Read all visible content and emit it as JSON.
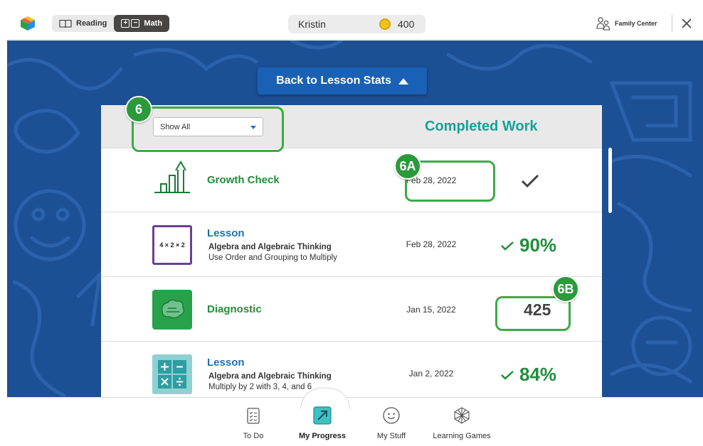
{
  "topbar": {
    "subjects": [
      {
        "label": "Reading",
        "active": false
      },
      {
        "label": "Math",
        "active": true
      }
    ],
    "user_name": "Kristin",
    "coins": "400",
    "family_center": "Family Center"
  },
  "stage": {
    "back_button": "Back to Lesson Stats",
    "filter_value": "Show All",
    "panel_title": "Completed Work"
  },
  "rows": [
    {
      "icon": "growth-check-icon",
      "title": "Growth Check",
      "date": "Feb 28, 2022",
      "result_icon": "checkmark-icon"
    },
    {
      "icon": "lesson-multiply-icon",
      "icon_text": "4 × 2 × 2",
      "title": "Lesson",
      "subtitle": "Algebra and Algebraic Thinking",
      "detail": "Use Order and Grouping to Multiply",
      "date": "Feb 28, 2022",
      "score": "90%"
    },
    {
      "icon": "diagnostic-brain-icon",
      "title": "Diagnostic",
      "date": "Jan 15, 2022",
      "score": "425"
    },
    {
      "icon": "lesson-operations-icon",
      "title": "Lesson",
      "subtitle": "Algebra and Algebraic Thinking",
      "detail": "Multiply by 2 with 3, 4, and 6",
      "date": "Jan 2, 2022",
      "score": "84%"
    }
  ],
  "callouts": {
    "filter": "6",
    "date": "6A",
    "score": "6B"
  },
  "nav": [
    {
      "label": "To Do",
      "icon": "todo-icon"
    },
    {
      "label": "My Progress",
      "icon": "progress-icon",
      "active": true
    },
    {
      "label": "My Stuff",
      "icon": "smiley-icon"
    },
    {
      "label": "Learning Games",
      "icon": "games-icon"
    }
  ],
  "colors": {
    "primary_blue": "#1a60b4",
    "teal": "#13a39b",
    "green": "#1f8f3a",
    "callout_green": "#3bab48",
    "background": "#1d4f94"
  }
}
